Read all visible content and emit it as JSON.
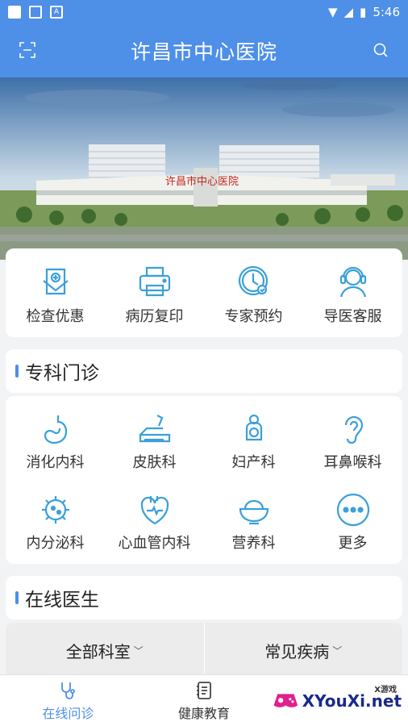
{
  "status_bar": {
    "time": "5:46"
  },
  "header": {
    "title": "许昌市中心医院"
  },
  "banner": {
    "sign_text": "许昌市中心医院"
  },
  "quick_actions": [
    {
      "label": "检查优惠",
      "icon": "clipboard-icon"
    },
    {
      "label": "病历复印",
      "icon": "printer-icon"
    },
    {
      "label": "专家预约",
      "icon": "clock-icon"
    },
    {
      "label": "导医客服",
      "icon": "headset-icon"
    }
  ],
  "specialty": {
    "title": "专科门诊",
    "items": [
      {
        "label": "消化内科",
        "icon": "stomach-icon"
      },
      {
        "label": "皮肤科",
        "icon": "skin-icon"
      },
      {
        "label": "妇产科",
        "icon": "maternity-icon"
      },
      {
        "label": "耳鼻喉科",
        "icon": "ear-icon"
      },
      {
        "label": "内分泌科",
        "icon": "gland-icon"
      },
      {
        "label": "心血管内科",
        "icon": "heart-icon"
      },
      {
        "label": "营养科",
        "icon": "bowl-icon"
      },
      {
        "label": "更多",
        "icon": "more-icon"
      }
    ]
  },
  "online": {
    "title": "在线医生",
    "filters": [
      {
        "label": "全部科室"
      },
      {
        "label": "常见疾病"
      }
    ]
  },
  "bottom_nav": [
    {
      "label": "在线问诊",
      "active": true
    },
    {
      "label": "健康教育",
      "active": false
    }
  ],
  "watermark": {
    "text": "XYouXi.net",
    "small": "X游戏"
  },
  "colors": {
    "primary": "#4e8fe8",
    "icon_accent": "#3aa0d8"
  }
}
